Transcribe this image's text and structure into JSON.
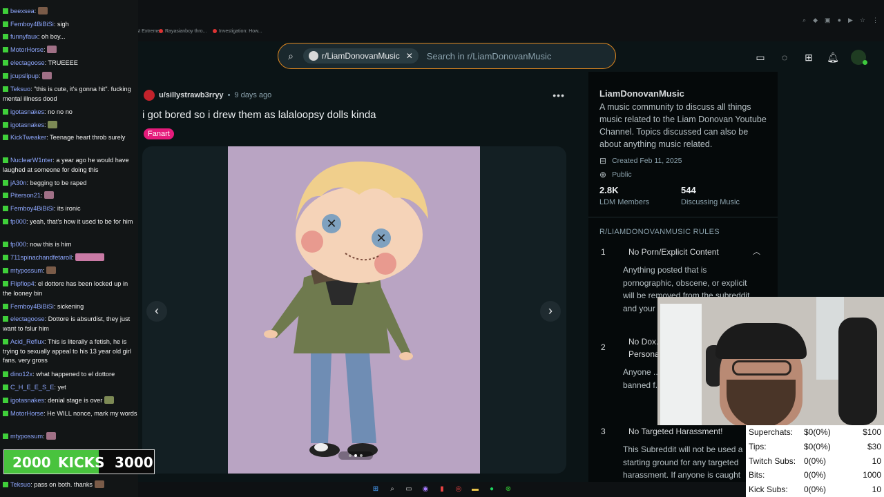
{
  "browser": {
    "bookmarks": [
      {
        "label": "The Most Extreme...",
        "color": "#d33"
      },
      {
        "label": "Rayasianboy thro...",
        "color": "#d33"
      },
      {
        "label": "Investigation: How...",
        "color": "#d33"
      }
    ]
  },
  "search": {
    "community_chip": "r/LiamDonovanMusic",
    "placeholder": "Search in r/LiamDonovanMusic"
  },
  "post": {
    "author": "u/sillystrawb3rryy",
    "time": "9 days ago",
    "title": "i got bored so i drew them as lalaloopsy dolls kinda",
    "flair": "Fanart",
    "gallery": {
      "total": 3,
      "current": 2
    }
  },
  "sidebar": {
    "name": "LiamDonovanMusic",
    "description": "A music community to discuss all things music related to the Liam Donovan Youtube Channel. Topics discussed can also be about anything music related.",
    "created": "Created Feb 11, 2025",
    "visibility": "Public",
    "stats": [
      {
        "value": "2.8K",
        "label": "LDM Members"
      },
      {
        "value": "544",
        "label": "Discussing Music"
      }
    ],
    "rules_header": "R/LIAMDONOVANMUSIC RULES",
    "rules": [
      {
        "num": "1",
        "title": "No Porn/Explicit Content",
        "body": "Anything posted that is pornographic, obscene, or explicit will be removed from the subreddit and your ... from the ..."
      },
      {
        "num": "2",
        "title": "No Dox...",
        "body2": "Persona...",
        "body": "Anyone ... private in... their post... banned f..."
      },
      {
        "num": "3",
        "title": "No Targeted Harassment!",
        "body": "This Subreddit will not be used a starting ground for any targeted harassment. If anyone is caught"
      }
    ]
  },
  "chat": [
    {
      "user": "beexsea",
      "text": "",
      "emote": "b"
    },
    {
      "user": "Femboy4BiBiSi",
      "text": "sigh"
    },
    {
      "user": "funnyfaux",
      "text": "oh boy..."
    },
    {
      "user": "MotorHorse",
      "text": "",
      "emote": "p"
    },
    {
      "user": "electagoose",
      "text": "TRUEEEE"
    },
    {
      "user": "jcupslipup",
      "text": "",
      "emote": "p"
    },
    {
      "user": "Teksuo",
      "text": "\"this is cute, it's gonna hit\". fucking mental illness dood"
    },
    {
      "user": "igotasnakes",
      "text": "no no no"
    },
    {
      "user": "igotasnakes",
      "text": "",
      "emote": "g"
    },
    {
      "user": "KickTweaker",
      "text": "Teenage heart throb surely"
    },
    {
      "user": "NuclearW1nter",
      "text": "a year ago he would have laughed at someone for doing this"
    },
    {
      "user": "jA30n",
      "text": "begging to be raped"
    },
    {
      "user": "Piterson21",
      "text": "",
      "emote": "p"
    },
    {
      "user": "Femboy4BiBiSi",
      "text": "its ironic"
    },
    {
      "user": "fp000",
      "text": "yeah, that's how it used to be for him"
    },
    {
      "user": "fp000",
      "text": "now this is him"
    },
    {
      "user": "711spinachandfetaroll",
      "text": "",
      "emote": "w"
    },
    {
      "user": "mtypossum",
      "text": "",
      "emote": "b"
    },
    {
      "user": "Flipflop4",
      "text": "el dottore has been locked up in the looney bin"
    },
    {
      "user": "Femboy4BiBiSi",
      "text": "sickening"
    },
    {
      "user": "electagoose",
      "text": "Dottore is absurdist, they just want to fslur him"
    },
    {
      "user": "Acid_Reflux",
      "text": "This is literally a fetish, he is trying to sexually appeal to his 13 year old girl fans. very gross"
    },
    {
      "user": "dino12x",
      "text": "what happened to el dottore"
    },
    {
      "user": "C_H_E_E_S_E",
      "text": "yet"
    },
    {
      "user": "igotasnakes",
      "text": "denial stage is over",
      "emote": "g"
    },
    {
      "user": "MotorHorse",
      "text": "He WILL nonce, mark my words"
    },
    {
      "user": "mtypossum",
      "text": "",
      "emote": "p"
    },
    {
      "user": "Teksuo",
      "text": "pass on both. thanks",
      "emote": "b"
    }
  ],
  "kick_goal": {
    "current": "2000",
    "label": "KICKS",
    "goal": "3000",
    "progress": 0.63
  },
  "stream_stats": [
    {
      "label": "Superchats:",
      "mid": "$0(0%)",
      "right": "$100"
    },
    {
      "label": "Tips:",
      "mid": "$0(0%)",
      "right": "$30"
    },
    {
      "label": "Twitch Subs:",
      "mid": "0(0%)",
      "right": "10"
    },
    {
      "label": "Bits:",
      "mid": "0(0%)",
      "right": "1000"
    },
    {
      "label": "Kick Subs:",
      "mid": "0(0%)",
      "right": "10"
    }
  ],
  "colors": {
    "accent": "#e58a1e",
    "flair": "#e51b7b",
    "kick": "#49c33e"
  }
}
